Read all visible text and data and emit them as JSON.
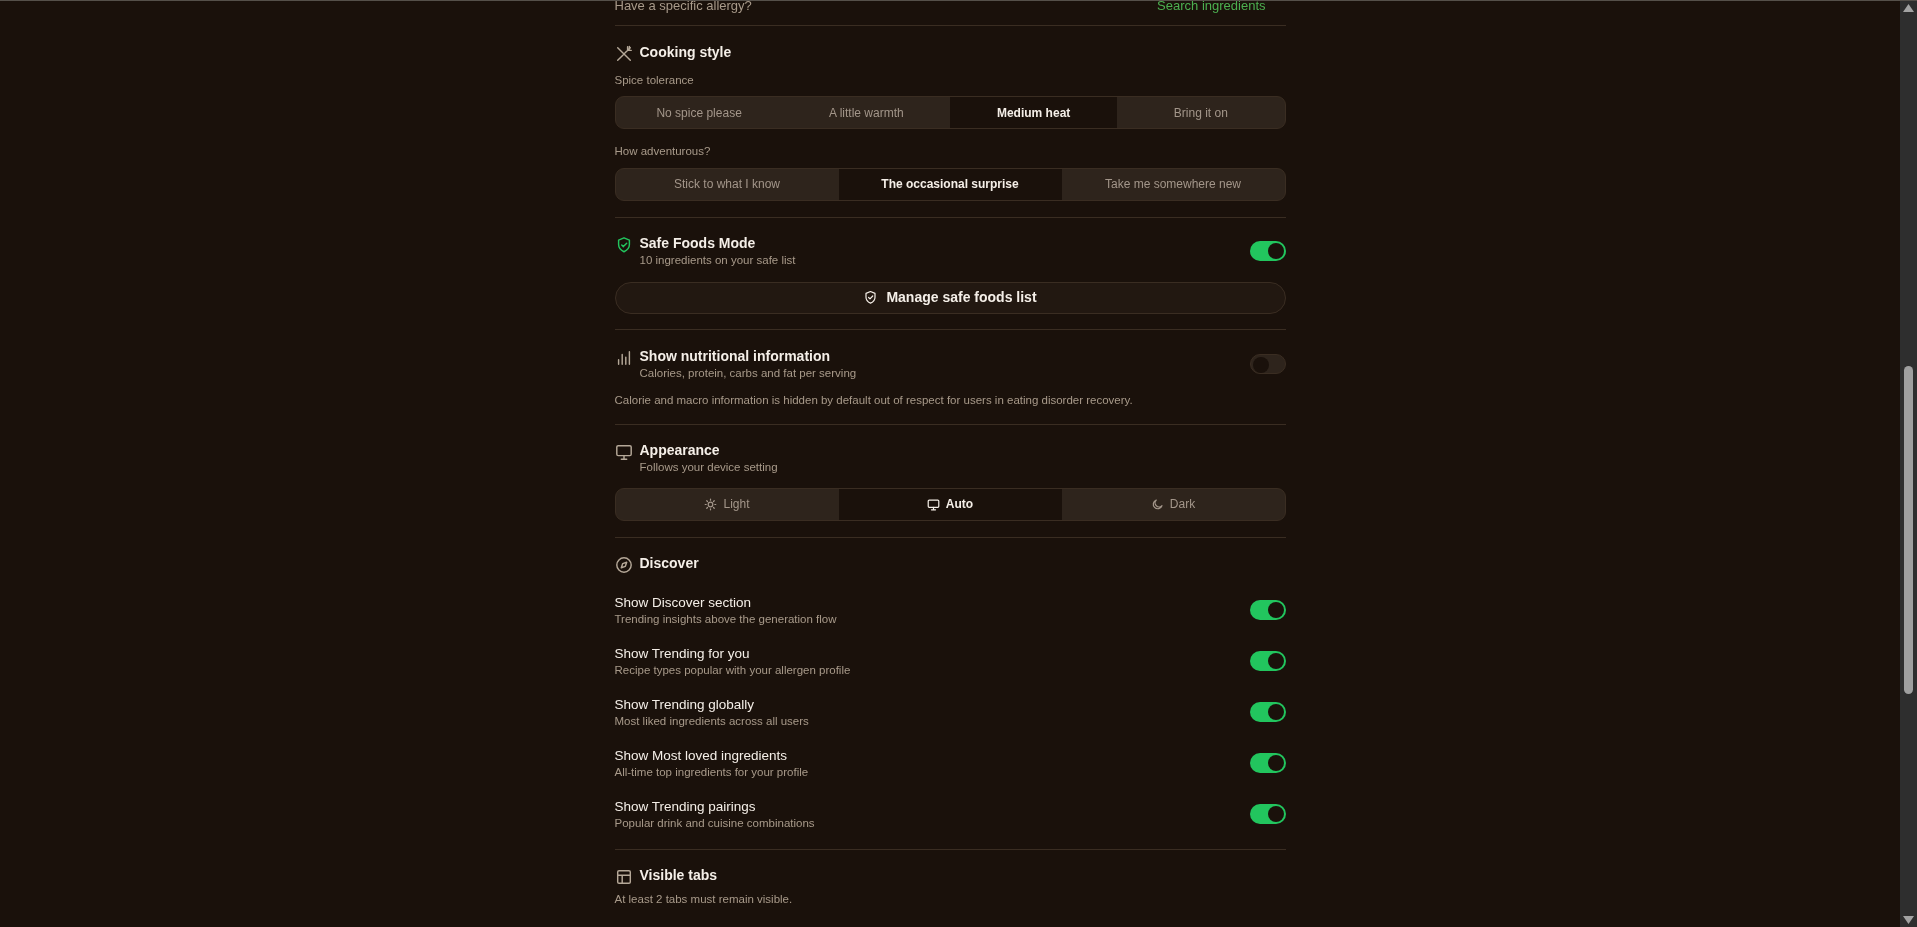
{
  "allergy_row": {
    "label": "Have a specific allergy?",
    "link": "Search ingredients"
  },
  "cooking_style": {
    "title": "Cooking style",
    "groups": [
      {
        "label": "Spice tolerance",
        "options": [
          {
            "label": "No spice please",
            "selected": false
          },
          {
            "label": "A little warmth",
            "selected": false
          },
          {
            "label": "Medium heat",
            "selected": true
          },
          {
            "label": "Bring it on",
            "selected": false
          }
        ]
      },
      {
        "label": "How adventurous?",
        "options": [
          {
            "label": "Stick to what I know",
            "selected": false
          },
          {
            "label": "The occasional surprise",
            "selected": true
          },
          {
            "label": "Take me somewhere new",
            "selected": false
          }
        ]
      }
    ]
  },
  "safe_foods": {
    "title": "Safe Foods Mode",
    "subtitle": "10 ingredients on your safe list",
    "on": true,
    "button": "Manage safe foods list"
  },
  "nutrition": {
    "title": "Show nutritional information",
    "subtitle": "Calories, protein, carbs and fat per serving",
    "on": false,
    "note": "Calorie and macro information is hidden by default out of respect for users in eating disorder recovery."
  },
  "appearance": {
    "title": "Appearance",
    "subtitle": "Follows your device setting",
    "options": [
      {
        "kind": "sun",
        "label": "Light",
        "selected": false
      },
      {
        "kind": "monitor",
        "label": "Auto",
        "selected": true
      },
      {
        "kind": "moon",
        "label": "Dark",
        "selected": false
      }
    ]
  },
  "discover": {
    "title": "Discover",
    "items": [
      {
        "title": "Show Discover section",
        "subtitle": "Trending insights above the generation flow",
        "on": true
      },
      {
        "title": "Show Trending for you",
        "subtitle": "Recipe types popular with your allergen profile",
        "on": true
      },
      {
        "title": "Show Trending globally",
        "subtitle": "Most liked ingredients across all users",
        "on": true
      },
      {
        "title": "Show Most loved ingredients",
        "subtitle": "All-time top ingredients for your profile",
        "on": true
      },
      {
        "title": "Show Trending pairings",
        "subtitle": "Popular drink and cuisine combinations",
        "on": true
      }
    ]
  },
  "visible_tabs": {
    "title": "Visible tabs",
    "subtitle": "At least 2 tabs must remain visible."
  }
}
